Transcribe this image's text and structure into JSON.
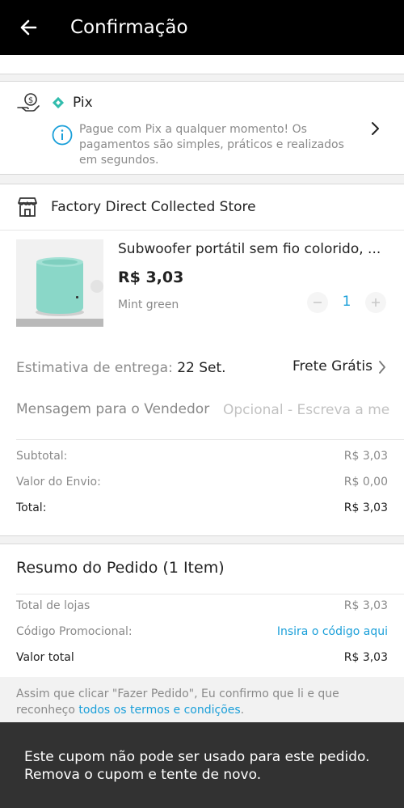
{
  "header": {
    "title": "Confirmação"
  },
  "payment": {
    "method": "Pix",
    "description": "Pague com Pix a qualquer momento! Os pagamentos são simples, práticos e realizados em segundos."
  },
  "store": {
    "name": "Factory Direct Collected Store"
  },
  "product": {
    "title": "Subwoofer portátil sem fio colorido, ...",
    "price": "R$ 3,03",
    "variant": "Mint green",
    "quantity": "1"
  },
  "delivery": {
    "label": "Estimativa de entrega: ",
    "date": "22 Set.",
    "shipping": "Frete Grátis"
  },
  "message": {
    "label": "Mensagem para o Vendedor",
    "placeholder": "Opcional - Escreva a mensagem"
  },
  "totals": {
    "subtotal_label": "Subtotal:",
    "subtotal_value": "R$ 3,03",
    "shipping_label": "Valor do Envio:",
    "shipping_value": "R$ 0,00",
    "total_label": "Total:",
    "total_value": "R$ 3,03"
  },
  "summary": {
    "title": "Resumo do Pedido (1 Item)",
    "stores_label": "Total de lojas",
    "stores_value": "R$ 3,03",
    "promo_label": "Código Promocional:",
    "promo_link": "Insira o código aqui",
    "total_label": "Valor total",
    "total_value": "R$ 3,03"
  },
  "terms": {
    "text": "Assim que clicar \"Fazer Pedido\", Eu confirmo que li e que reconheço ",
    "link": "todos os termos e condições",
    "end": "."
  },
  "toast": {
    "line1": "Este cupom não pode ser usado para este pedido.",
    "line2": "Remova o cupom e tente de novo."
  },
  "colors": {
    "accent": "#1a9fd9",
    "pix": "#32bcad",
    "product": "#8ad7c8"
  }
}
